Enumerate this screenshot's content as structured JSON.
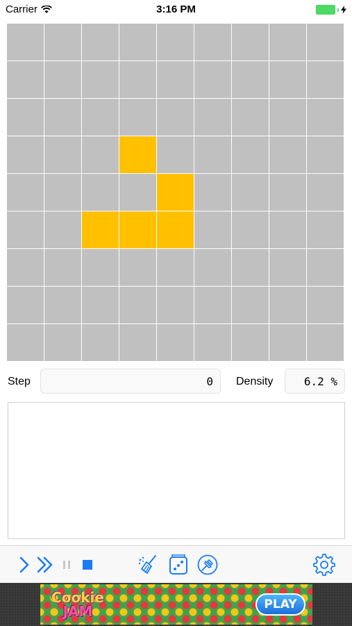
{
  "status_bar": {
    "carrier": "Carrier",
    "time": "3:16 PM"
  },
  "board": {
    "rows": 9,
    "cols": 9,
    "dead_color": "#c0c0c0",
    "alive_color": "#ffc000",
    "alive_cells": [
      [
        3,
        3
      ],
      [
        4,
        4
      ],
      [
        5,
        2
      ],
      [
        5,
        3
      ],
      [
        5,
        4
      ]
    ]
  },
  "stats": {
    "step_label": "Step",
    "step_value": "0",
    "density_label": "Density",
    "density_value": "6.2 %"
  },
  "log": {
    "text": ""
  },
  "toolbar": {
    "accent_color": "#1a7cf5",
    "items": [
      {
        "name": "step-button",
        "icon": "chevron-right-icon"
      },
      {
        "name": "run-button",
        "icon": "double-chevron-right-icon"
      },
      {
        "name": "pause-button",
        "icon": "pause-icon"
      },
      {
        "name": "stop-button",
        "icon": "stop-square-icon"
      },
      {
        "name": "clear-button",
        "icon": "broom-icon"
      },
      {
        "name": "random-button",
        "icon": "dice-icon"
      },
      {
        "name": "pin-button",
        "icon": "pin-icon"
      },
      {
        "name": "settings-button",
        "icon": "gear-icon"
      }
    ]
  },
  "ad": {
    "logo_line1": "Cookie",
    "logo_line2": "JAM",
    "play_label": "PLAY"
  }
}
